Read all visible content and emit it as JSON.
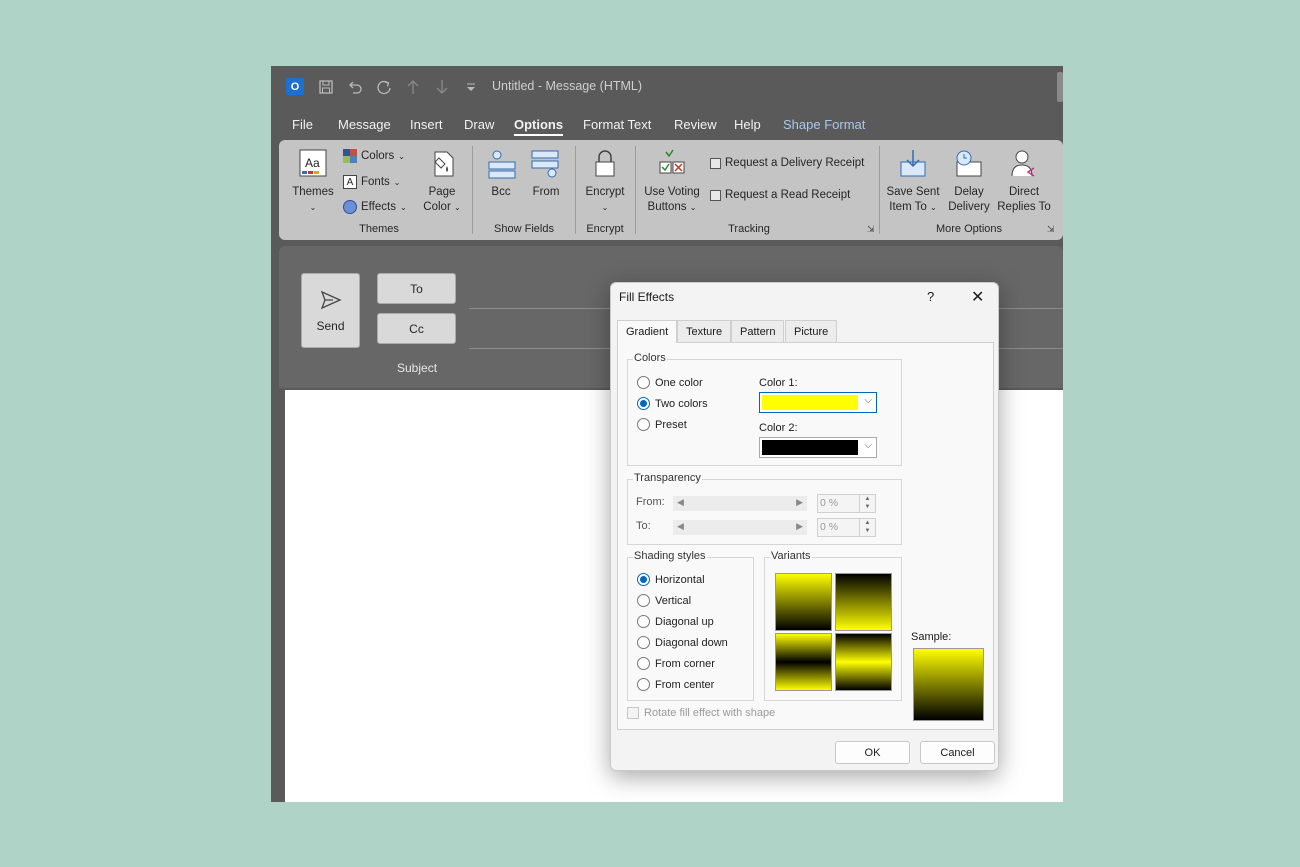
{
  "window": {
    "app_initial": "O",
    "title": "Untitled  -  Message (HTML)",
    "quick_access": [
      "save-icon",
      "undo-icon",
      "redo-icon",
      "up-arrow-icon",
      "down-arrow-icon",
      "customize-icon"
    ]
  },
  "menu": {
    "tabs": [
      "File",
      "Message",
      "Insert",
      "Draw",
      "Options",
      "Format Text",
      "Review",
      "Help",
      "Shape Format"
    ],
    "active": "Options"
  },
  "ribbon": {
    "themes": {
      "themes_label": "Themes",
      "colors_label": "Colors",
      "fonts_label": "Fonts",
      "effects_label": "Effects",
      "page_color_line1": "Page",
      "page_color_line2": "Color",
      "group": "Themes"
    },
    "show_fields": {
      "bcc": "Bcc",
      "from": "From",
      "group": "Show Fields"
    },
    "encrypt": {
      "label": "Encrypt",
      "group": "Encrypt"
    },
    "tracking": {
      "voting_line1": "Use Voting",
      "voting_line2": "Buttons",
      "delivery_receipt": "Request a Delivery Receipt",
      "read_receipt": "Request a Read Receipt",
      "group": "Tracking"
    },
    "more_options": {
      "save_sent_line1": "Save Sent",
      "save_sent_line2": "Item To",
      "delay_line1": "Delay",
      "delay_line2": "Delivery",
      "direct_line1": "Direct",
      "direct_line2": "Replies To",
      "group": "More Options"
    }
  },
  "compose": {
    "send": "Send",
    "to": "To",
    "cc": "Cc",
    "subject": "Subject"
  },
  "dialog": {
    "title": "Fill Effects",
    "help": "?",
    "tabs": [
      "Gradient",
      "Texture",
      "Pattern",
      "Picture"
    ],
    "active_tab": "Gradient",
    "colors": {
      "legend": "Colors",
      "one_color": "One color",
      "two_colors": "Two colors",
      "preset": "Preset",
      "selected": "Two colors",
      "color1_label": "Color 1:",
      "color2_label": "Color 2:",
      "color1": "#ffff00",
      "color2": "#000000"
    },
    "transparency": {
      "legend": "Transparency",
      "from_label": "From:",
      "to_label": "To:",
      "from_value": "0 %",
      "to_value": "0 %"
    },
    "shading": {
      "legend": "Shading styles",
      "options": [
        "Horizontal",
        "Vertical",
        "Diagonal up",
        "Diagonal down",
        "From corner",
        "From center"
      ],
      "selected": "Horizontal"
    },
    "variants_legend": "Variants",
    "sample_label": "Sample:",
    "rotate_label": "Rotate fill effect with shape",
    "ok": "OK",
    "cancel": "Cancel"
  }
}
